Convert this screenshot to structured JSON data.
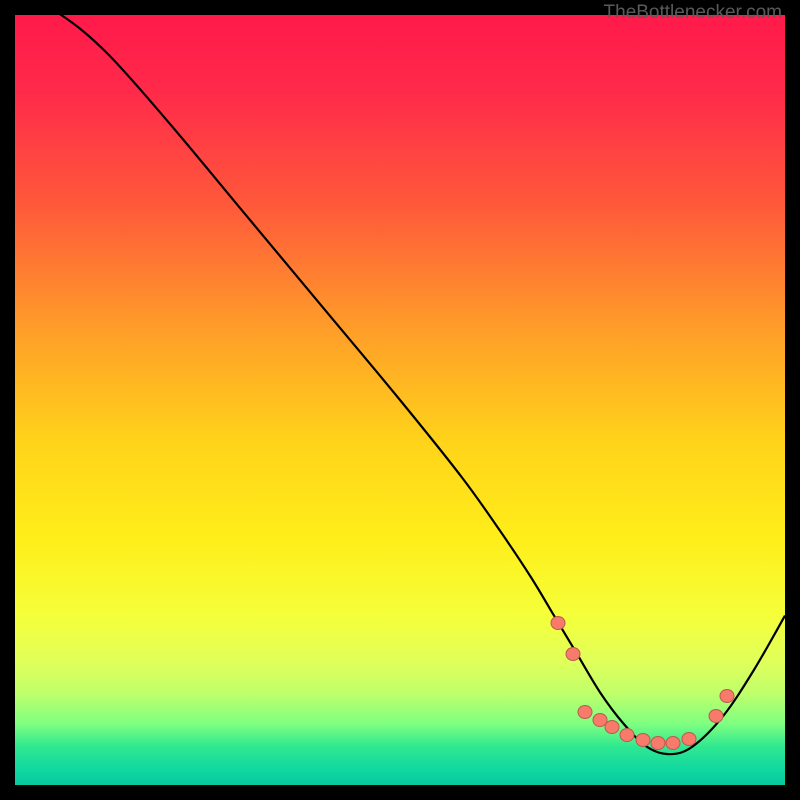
{
  "watermark": "TheBottlenecker.com",
  "chart_data": {
    "type": "line",
    "title": "",
    "xlabel": "",
    "ylabel": "",
    "xlim": [
      0,
      100
    ],
    "ylim": [
      0,
      100
    ],
    "curve": {
      "name": "bottleneck-curve",
      "x": [
        0,
        6,
        12,
        20,
        30,
        40,
        50,
        58,
        63,
        67,
        70,
        73,
        76,
        79,
        82,
        85,
        88,
        92,
        96,
        100
      ],
      "y": [
        103,
        100,
        95,
        86,
        74,
        62,
        50,
        40,
        33,
        27,
        22,
        17,
        12,
        8,
        5,
        4,
        5,
        9,
        15,
        22
      ]
    },
    "markers": {
      "name": "optimal-range",
      "points": [
        {
          "x": 70.5,
          "y": 21
        },
        {
          "x": 72.5,
          "y": 17
        },
        {
          "x": 74.0,
          "y": 9.5
        },
        {
          "x": 76.0,
          "y": 8.5
        },
        {
          "x": 77.5,
          "y": 7.5
        },
        {
          "x": 79.5,
          "y": 6.5
        },
        {
          "x": 81.5,
          "y": 5.8
        },
        {
          "x": 83.5,
          "y": 5.5
        },
        {
          "x": 85.5,
          "y": 5.5
        },
        {
          "x": 87.5,
          "y": 6.0
        },
        {
          "x": 91.0,
          "y": 9.0
        },
        {
          "x": 92.5,
          "y": 11.5
        }
      ]
    },
    "gradient_meaning": "red=high bottleneck, green=low bottleneck"
  }
}
